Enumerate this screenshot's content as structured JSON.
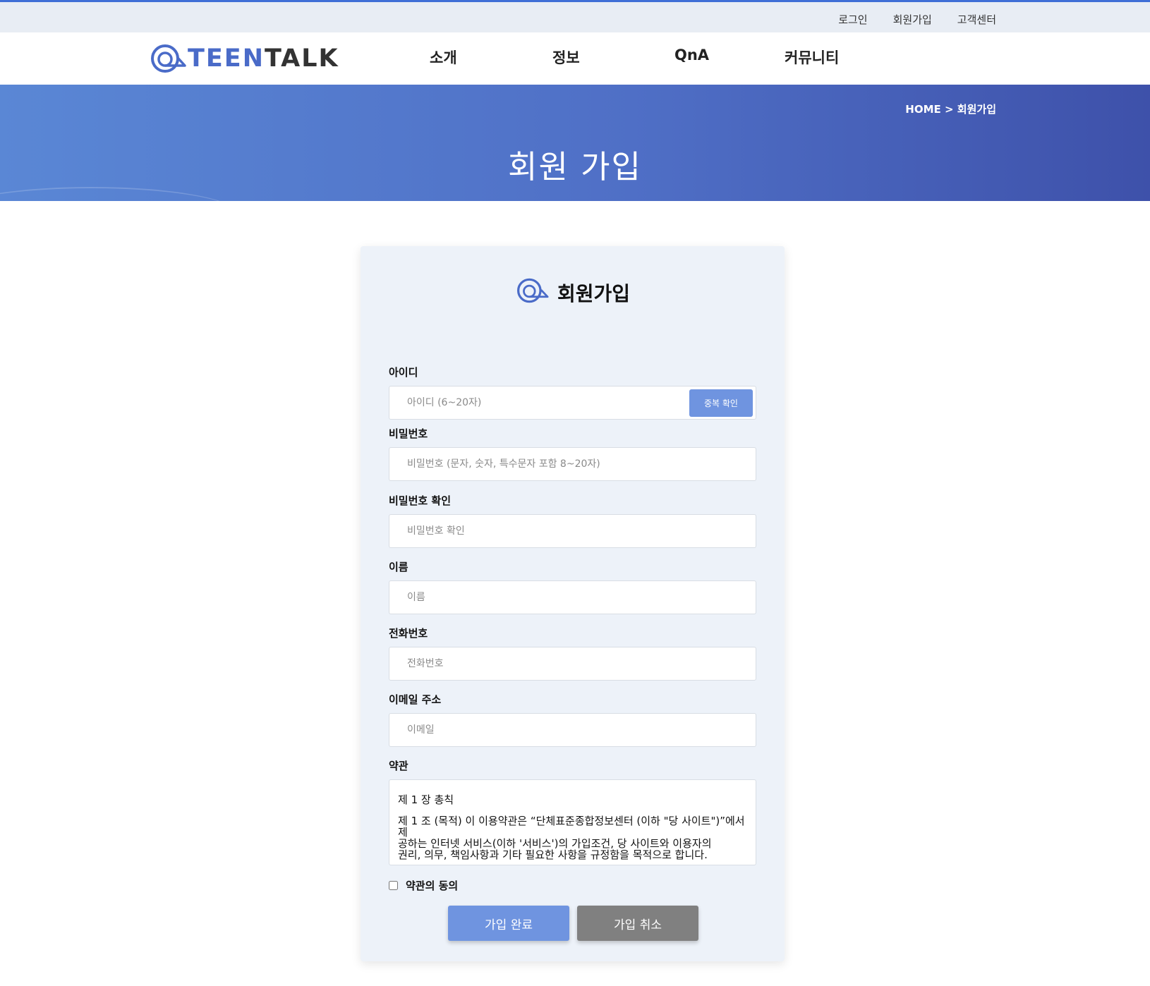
{
  "util_nav": {
    "login": "로그인",
    "signup": "회원가입",
    "support": "고객센터"
  },
  "logo": {
    "text_teen": "TEEN",
    "text_talk": "TALK"
  },
  "main_nav": {
    "intro": "소개",
    "info": "정보",
    "qna": "QnA",
    "community": "커뮤니티"
  },
  "banner": {
    "breadcrumb": "HOME > 회원가입",
    "title": "회원 가입"
  },
  "form": {
    "title": "회원가입",
    "id_label": "아이디",
    "id_placeholder": "아이디 (6~20자)",
    "dup_check": "중복 확인",
    "pw_label": "비밀번호",
    "pw_placeholder": "비밀번호 (문자, 숫자, 특수문자 포함 8~20자)",
    "pw2_label": "비밀번호 확인",
    "pw2_placeholder": "비밀번호 확인",
    "name_label": "이름",
    "name_placeholder": "이름",
    "phone_label": "전화번호",
    "phone_placeholder": "전화번호",
    "email_label": "이메일 주소",
    "email_placeholder": "이메일",
    "terms_label": "약관",
    "terms_heading": "제 1 장 총칙",
    "terms_line1": "제 1 조 (목적) 이 이용약관은 “단체표준종합정보센터 (이하 \"당 사이트\")”에서 제",
    "terms_line2": "공하는 인터넷 서비스(이하 '서비스')의 가입조건, 당 사이트와 이용자의",
    "terms_line3": "권리, 의무, 책임사항과 기타 필요한 사항을 규정함을 목적으로 합니다.",
    "agree_label": "약관의 동의",
    "submit": "가입 완료",
    "cancel": "가입 취소"
  },
  "colors": {
    "accent": "#6f94e0",
    "banner_start": "#5a87d5",
    "banner_end": "#3e51aa",
    "cancel": "#808080"
  }
}
